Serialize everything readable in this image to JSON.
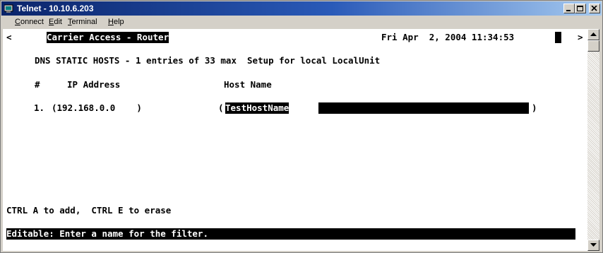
{
  "window": {
    "title": "Telnet - 10.10.6.203",
    "icon": "telnet-app-icon",
    "controls": {
      "minimize": "minimize-icon",
      "maximize": "maximize-icon",
      "close": "close-icon"
    }
  },
  "menu": {
    "items": [
      {
        "label": "Connect",
        "accel": "C"
      },
      {
        "label": "Edit",
        "accel": "E"
      },
      {
        "label": "Terminal",
        "accel": "T"
      },
      {
        "label": "Help",
        "accel": "H"
      }
    ]
  },
  "terminal": {
    "nav_left": "<",
    "nav_right": ">",
    "header_title": "Carrier Access - Router",
    "datetime": "Fri Apr  2, 2004 11:34:53",
    "screen_title": "DNS STATIC HOSTS - 1 entries of 33 max  Setup for local LocalUnit",
    "columns": {
      "num": "#",
      "ip": "IP Address",
      "host": "Host Name"
    },
    "rows": [
      {
        "num": "1.",
        "ip": "(192.168.0.0    )",
        "host_open": "(",
        "host": "TestHostName",
        "host_close": ")"
      }
    ],
    "hint": "CTRL A to add,  CTRL E to erase",
    "status": "Editable: Enter a name for the filter."
  },
  "scrollbar": {
    "up_icon": "scroll-up-arrow-icon",
    "down_icon": "scroll-down-arrow-icon"
  }
}
